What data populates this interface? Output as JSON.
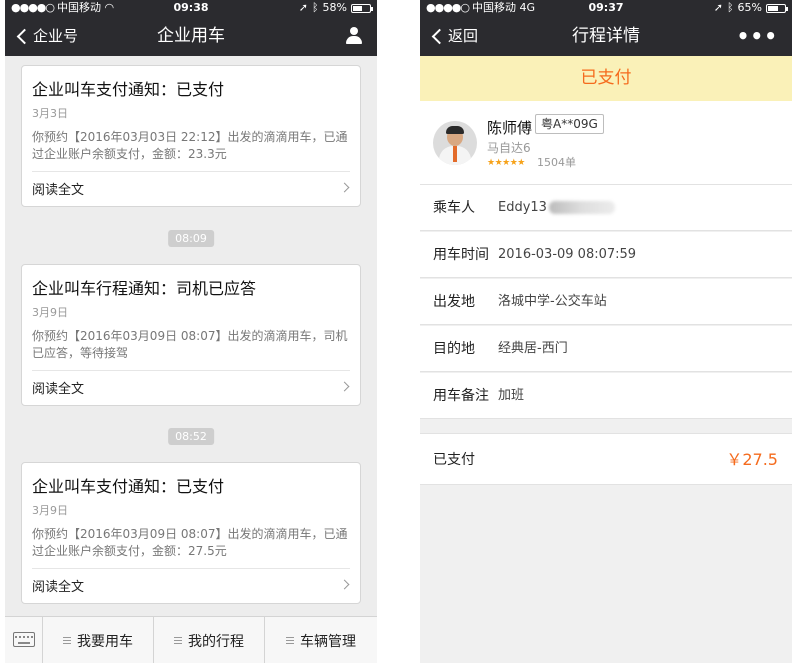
{
  "left": {
    "status": {
      "carrier": "中国移动",
      "network": "",
      "time": "09:38",
      "battery": "58%",
      "battery_level": 0.58
    },
    "nav": {
      "back_label": "企业号",
      "title": "企业用车"
    },
    "cards": [
      {
        "title": "企业叫车支付通知：已支付",
        "date": "3月3日",
        "body": "你预约【2016年03月03日 22:12】出发的滴滴用车，已通过企业账户余额支付，金额：23.3元",
        "read_more": "阅读全文"
      },
      {
        "title": "企业叫车行程通知：司机已应答",
        "date": "3月9日",
        "body": "你预约【2016年03月09日 08:07】出发的滴滴用车，司机已应答，等待接驾",
        "read_more": "阅读全文"
      },
      {
        "title": "企业叫车支付通知：已支付",
        "date": "3月9日",
        "body": "你预约【2016年03月09日 08:07】出发的滴滴用车，已通过企业账户余额支付，金额：27.5元",
        "read_more": "阅读全文"
      }
    ],
    "time_separators": [
      "08:09",
      "08:52"
    ],
    "menu": [
      "我要用车",
      "我的行程",
      "车辆管理"
    ]
  },
  "right": {
    "status": {
      "carrier": "中国移动",
      "network": "4G",
      "time": "09:37",
      "battery": "65%",
      "battery_level": 0.65
    },
    "nav": {
      "back_label": "返回",
      "title": "行程详情"
    },
    "banner": "已支付",
    "driver": {
      "name": "陈师傅",
      "plate": "粤A**09G",
      "car": "马自达6",
      "rating": 5,
      "orders": "1504单"
    },
    "details": [
      {
        "label": "乘车人",
        "value": "Eddy13"
      },
      {
        "label": "用车时间",
        "value": "2016-03-09 08:07:59"
      },
      {
        "label": "出发地",
        "value": "洛城中学-公交车站"
      },
      {
        "label": "目的地",
        "value": "经典居-西门"
      },
      {
        "label": "用车备注",
        "value": "加班"
      }
    ],
    "payment": {
      "label": "已支付",
      "amount": "￥27.5"
    }
  },
  "colors": {
    "nav_bg": "#2b2b2f",
    "accent_orange": "#f56b1d",
    "banner_bg": "#faf1b8",
    "star": "#f6a21a"
  }
}
